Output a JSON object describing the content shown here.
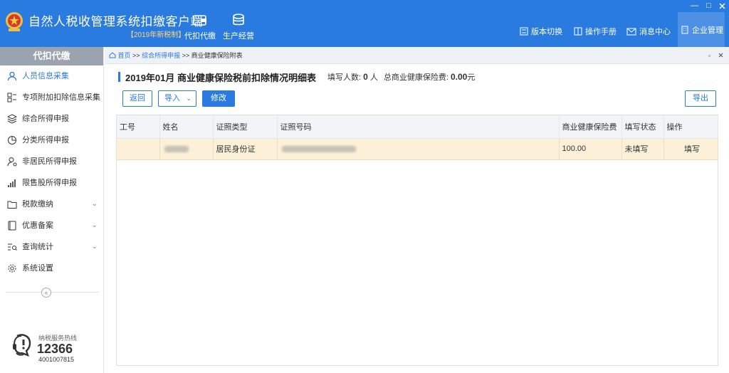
{
  "header": {
    "app_title": "自然人税收管理系统扣缴客户端",
    "edition": "【2019年新税制】",
    "nav": [
      {
        "label": "代扣代缴",
        "icon": "wallet-icon"
      },
      {
        "label": "生产经营",
        "icon": "coins-icon"
      }
    ],
    "right_menu": [
      {
        "label": "版本切换",
        "icon": "switch-icon"
      },
      {
        "label": "操作手册",
        "icon": "manual-icon"
      },
      {
        "label": "消息中心",
        "icon": "mail-icon"
      },
      {
        "label": "企业管理",
        "icon": "building-icon"
      }
    ],
    "window_controls": [
      "—",
      "□"
    ],
    "accent_color": "#2a7be0"
  },
  "sidebar": {
    "title": "代扣代缴",
    "items": [
      {
        "label": "人员信息采集",
        "icon": "user-icon",
        "active": true
      },
      {
        "label": "专项附加扣除信息采集",
        "icon": "grid-icon",
        "expandable": true
      },
      {
        "label": "综合所得申报",
        "icon": "layers-icon"
      },
      {
        "label": "分类所得申报",
        "icon": "pie-icon"
      },
      {
        "label": "非居民所得申报",
        "icon": "person-icon"
      },
      {
        "label": "限售股所得申报",
        "icon": "bars-icon"
      },
      {
        "label": "税款缴纳",
        "icon": "folder-icon",
        "expandable": true
      },
      {
        "label": "优惠备案",
        "icon": "doc-icon",
        "expandable": true
      },
      {
        "label": "查询统计",
        "icon": "search-list-icon",
        "expandable": true
      },
      {
        "label": "系统设置",
        "icon": "gear-icon"
      }
    ],
    "collapse_glyph": "«",
    "hotline": {
      "label": "纳税服务热线",
      "number": "12366",
      "number2": "4001007815"
    }
  },
  "breadcrumb": {
    "home": "首页",
    "sep1": ">>",
    "level1": "综合所得申报",
    "sep2": ">>",
    "current": "商业健康保险附表"
  },
  "page": {
    "title": "2019年01月 商业健康保险税前扣除情况明细表",
    "stat_count_label": "填写人数:",
    "stat_count_value": "0",
    "stat_count_unit": "人",
    "stat_total_label": "总商业健康保险费:",
    "stat_total_value": "0.00",
    "stat_total_unit": "元"
  },
  "toolbar": {
    "back": "返回",
    "import": "导入",
    "modify": "修改",
    "export": "导出"
  },
  "table": {
    "headers": [
      "工号",
      "姓名",
      "证照类型",
      "证照号码",
      "商业健康保险费",
      "填写状态",
      "操作"
    ],
    "rows": [
      {
        "id": "",
        "name": "",
        "id_type": "居民身份证",
        "id_number": "",
        "premium": "100.00",
        "status": "未填写",
        "action": "填写"
      }
    ]
  }
}
